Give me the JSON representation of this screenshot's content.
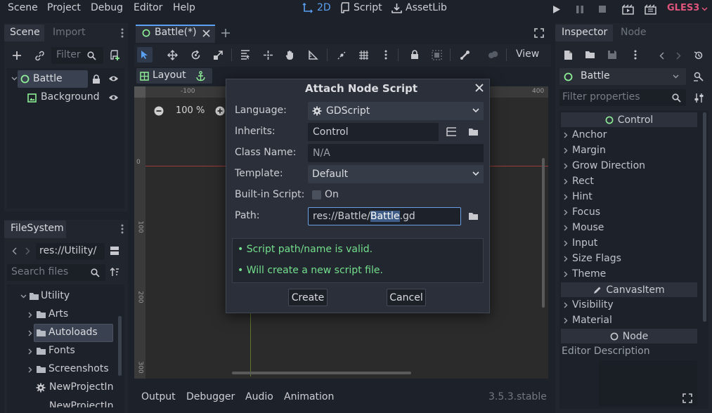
{
  "menubar": {
    "items": [
      "Scene",
      "Project",
      "Debug",
      "Editor",
      "Help"
    ],
    "modes": {
      "d2": "2D",
      "script": "Script",
      "assetlib": "AssetLib"
    },
    "renderer": "GLES3"
  },
  "scene_dock": {
    "tabs": {
      "scene": "Scene",
      "import": "Import"
    },
    "filter_placeholder": "Filter",
    "tree": [
      {
        "label": "Battle"
      },
      {
        "label": "Background"
      }
    ]
  },
  "filesystem_dock": {
    "title": "FileSystem",
    "path": "res://Utility/",
    "search_placeholder": "Search files",
    "items": [
      {
        "label": "Utility"
      },
      {
        "label": "Arts"
      },
      {
        "label": "Autoloads"
      },
      {
        "label": "Fonts"
      },
      {
        "label": "Screenshots"
      },
      {
        "label": "NewProjectIn"
      },
      {
        "label": "NewProjectIn"
      }
    ]
  },
  "editor": {
    "tab_label": "Battle(*)",
    "view_label": "View",
    "layout_label": "Layout",
    "zoom": "100 %",
    "ruler_labels": {
      "h_neg100": "-100",
      "h_400": "400",
      "v_0": "0",
      "v_100": "100",
      "v_200": "200",
      "v_300": "300"
    }
  },
  "bottom_panel": {
    "tabs": [
      "Output",
      "Debugger",
      "Audio",
      "Animation"
    ],
    "version": "3.5.3.stable"
  },
  "dialog": {
    "title": "Attach Node Script",
    "language_label": "Language:",
    "language_value": "GDScript",
    "inherits_label": "Inherits:",
    "inherits_value": "Control",
    "classname_label": "Class Name:",
    "classname_value": "N/A",
    "template_label": "Template:",
    "template_value": "Default",
    "builtin_label": "Built-in Script:",
    "builtin_value": "On",
    "path_label": "Path:",
    "path_prefix": "res://Battle/",
    "path_selected": "Battle",
    "path_suffix": ".gd",
    "messages": [
      "• Script path/name is valid.",
      "• Will create a new script file."
    ],
    "create_label": "Create",
    "cancel_label": "Cancel"
  },
  "inspector": {
    "tabs": {
      "inspector": "Inspector",
      "node": "Node"
    },
    "node_name": "Battle",
    "filter_placeholder": "Filter properties",
    "control_section": "Control",
    "control_items": [
      "Anchor",
      "Margin",
      "Grow Direction",
      "Rect",
      "Hint",
      "Focus",
      "Mouse",
      "Input",
      "Size Flags",
      "Theme"
    ],
    "canvasitem_section": "CanvasItem",
    "canvasitem_items": [
      "Visibility",
      "Material"
    ],
    "node_section": "Node",
    "editor_description": "Editor Description"
  },
  "colors": {
    "accent": "#5aa0f2",
    "node_green": "#8eef97",
    "ok_text": "#74df8d",
    "renderer_pink": "#e0557c"
  }
}
